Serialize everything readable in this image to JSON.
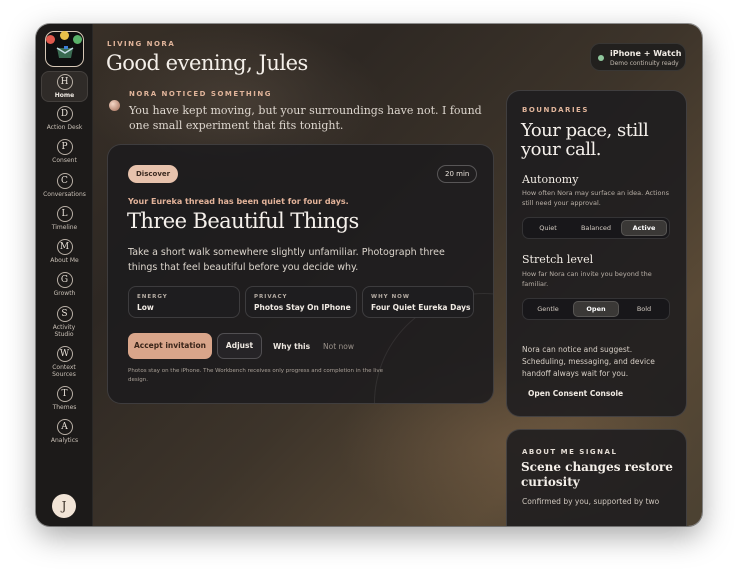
{
  "app": {
    "brand_colors": [
      "#e05a4e",
      "#e8c04a",
      "#5ab26a",
      "#3d7fd8"
    ]
  },
  "sidebar": {
    "items": [
      {
        "letter": "H",
        "label": "Home",
        "active": true
      },
      {
        "letter": "D",
        "label": "Action Desk"
      },
      {
        "letter": "P",
        "label": "Consent"
      },
      {
        "letter": "C",
        "label": "Conversations"
      },
      {
        "letter": "L",
        "label": "Timeline"
      },
      {
        "letter": "M",
        "label": "About Me"
      },
      {
        "letter": "G",
        "label": "Growth"
      },
      {
        "letter": "S",
        "label": "Activity Studio"
      },
      {
        "letter": "W",
        "label": "Context Sources"
      },
      {
        "letter": "T",
        "label": "Themes"
      },
      {
        "letter": "A",
        "label": "Analytics"
      }
    ],
    "avatar_initial": "J"
  },
  "header": {
    "eyebrow": "LIVING NORA",
    "greeting": "Good evening, Jules",
    "device": {
      "title": "iPhone + Watch",
      "subtitle": "Demo continuity ready"
    }
  },
  "notice": {
    "eyebrow": "NORA NOTICED SOMETHING",
    "text": "You have kept moving, but your surroundings have not. I found one small experiment that fits tonight."
  },
  "discover_card": {
    "tag": "Discover",
    "duration": "20 min",
    "kicker": "Your Eureka thread has been quiet for four days.",
    "title": "Three Beautiful Things",
    "body": "Take a short walk somewhere slightly unfamiliar. Photograph three things that feel beautiful before you decide why.",
    "stats": [
      {
        "label": "ENERGY",
        "value": "Low"
      },
      {
        "label": "PRIVACY",
        "value": "Photos Stay On IPhone"
      },
      {
        "label": "WHY NOW",
        "value": "Four Quiet Eureka Days"
      }
    ],
    "actions": {
      "accept": "Accept invitation",
      "adjust": "Adjust",
      "why": "Why this",
      "not_now": "Not now"
    },
    "footnote": "Photos stay on the iPhone. The Workbench receives only progress and completion in the live design."
  },
  "boundaries": {
    "eyebrow": "BOUNDARIES",
    "title": "Your pace, still your call.",
    "autonomy": {
      "title": "Autonomy",
      "description": "How often Nora may surface an idea. Actions still need your approval.",
      "options": [
        "Quiet",
        "Balanced",
        "Active"
      ],
      "selected": "Active"
    },
    "stretch": {
      "title": "Stretch level",
      "description": "How far Nora can invite you beyond the familiar.",
      "options": [
        "Gentle",
        "Open",
        "Bold"
      ],
      "selected": "Open"
    },
    "note": "Nora can notice and suggest. Scheduling, messaging, and device handoff always wait for you.",
    "link": "Open Consent Console"
  },
  "about_signal": {
    "eyebrow": "ABOUT ME SIGNAL",
    "title": "Scene changes restore curiosity",
    "description": "Confirmed by you, supported by two"
  },
  "colors": {
    "accent": "#e0b49a",
    "accept_button": "#d9a58a",
    "status_dot": "#8fc79d"
  }
}
